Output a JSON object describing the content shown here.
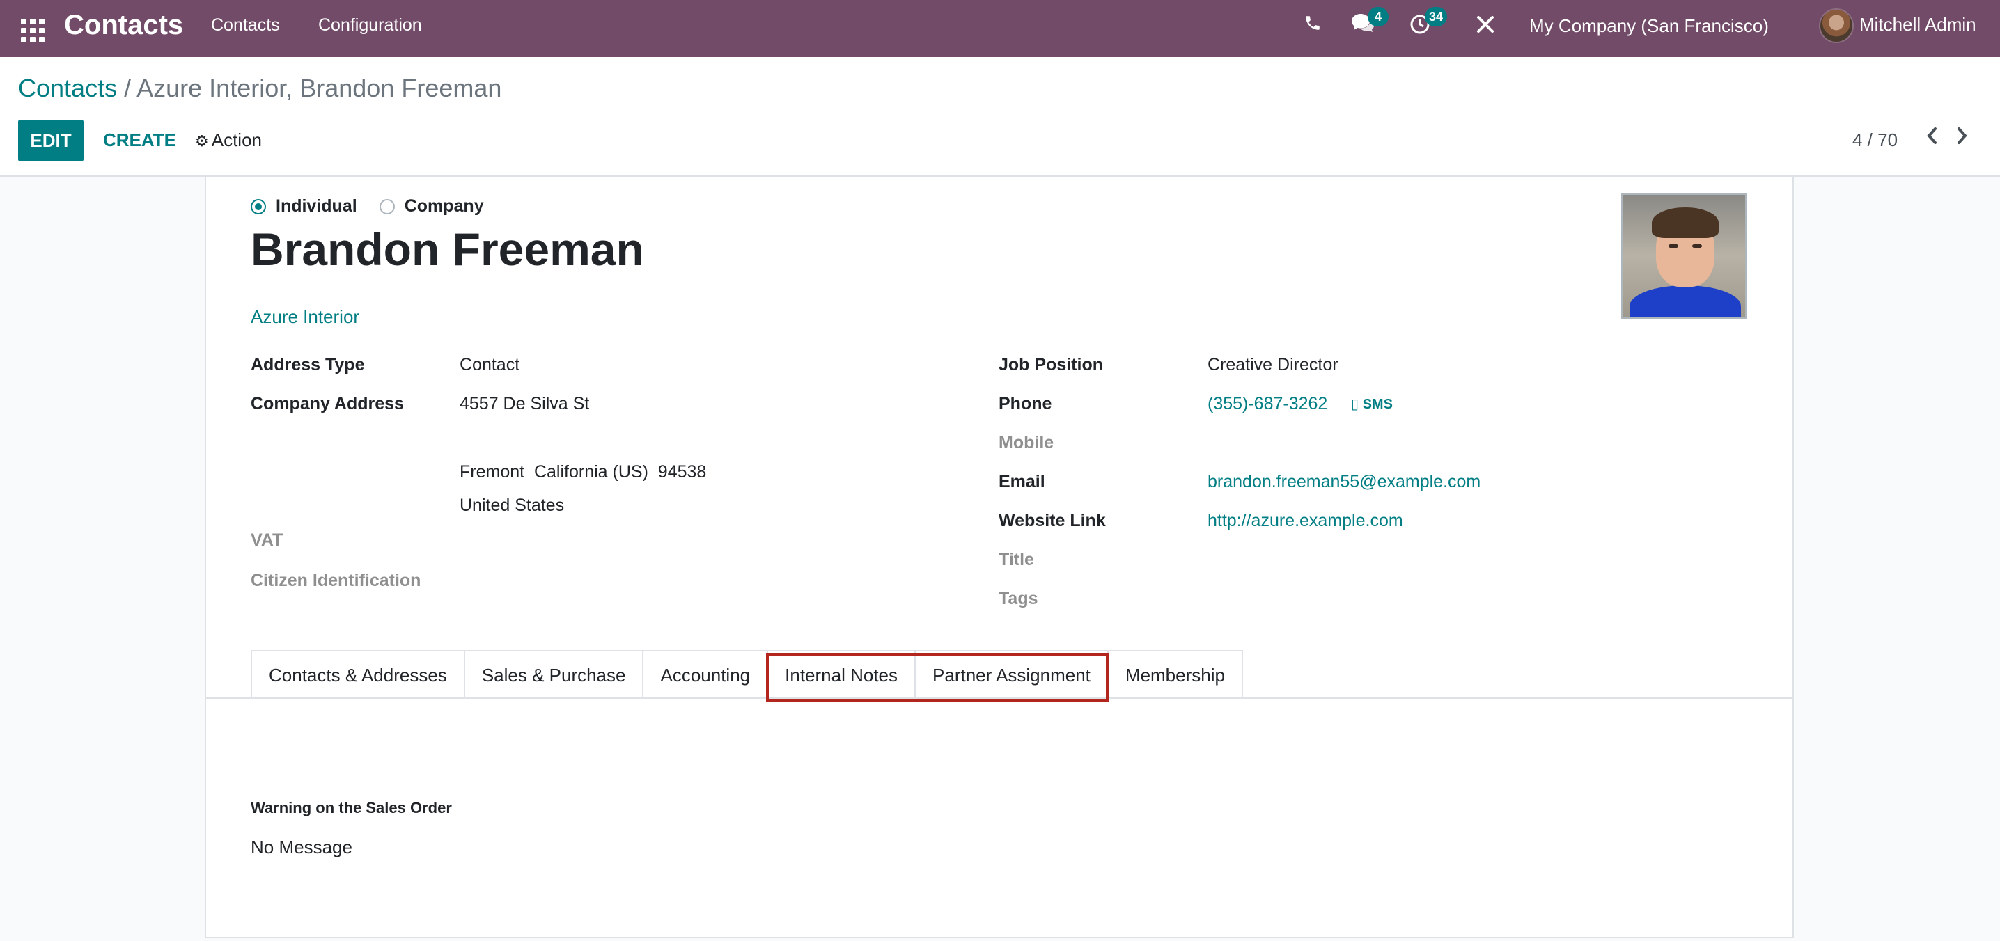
{
  "navbar": {
    "brand": "Contacts",
    "menus": [
      "Contacts",
      "Configuration"
    ],
    "messages_count": "4",
    "activities_count": "34",
    "company": "My Company (San Francisco)",
    "user": "Mitchell Admin"
  },
  "breadcrumb": {
    "parent": "Contacts",
    "separator": "/",
    "current": "Azure Interior, Brandon Freeman"
  },
  "toolbar": {
    "edit_label": "EDIT",
    "create_label": "CREATE",
    "action_label": "Action",
    "pager_value": "4 / 70"
  },
  "form": {
    "company_type_options": [
      "Individual",
      "Company"
    ],
    "selected_type": "Individual",
    "name": "Brandon Freeman",
    "parent_company": "Azure Interior",
    "left_fields": {
      "address_type_label": "Address Type",
      "address_type_value": "Contact",
      "company_address_label": "Company Address",
      "street": "4557 De Silva St",
      "city_line": "Fremont  California (US)  94538",
      "country": "United States",
      "vat_label": "VAT",
      "citizen_id_label": "Citizen Identification"
    },
    "right_fields": {
      "job_position_label": "Job Position",
      "job_position_value": "Creative Director",
      "phone_label": "Phone",
      "phone_value": "(355)-687-3262",
      "sms_label": "SMS",
      "mobile_label": "Mobile",
      "email_label": "Email",
      "email_value": "brandon.freeman55@example.com",
      "website_label": "Website Link",
      "website_value": "http://azure.example.com",
      "title_label": "Title",
      "tags_label": "Tags"
    }
  },
  "tabs": [
    "Contacts & Addresses",
    "Sales & Purchase",
    "Accounting",
    "Internal Notes",
    "Partner Assignment",
    "Membership"
  ],
  "internal_notes": {
    "warning_label": "Warning on the Sales Order",
    "warning_value": "No Message"
  },
  "colors": {
    "navbar": "#714b67",
    "accent": "#017e84",
    "highlight": "#b3261e"
  }
}
